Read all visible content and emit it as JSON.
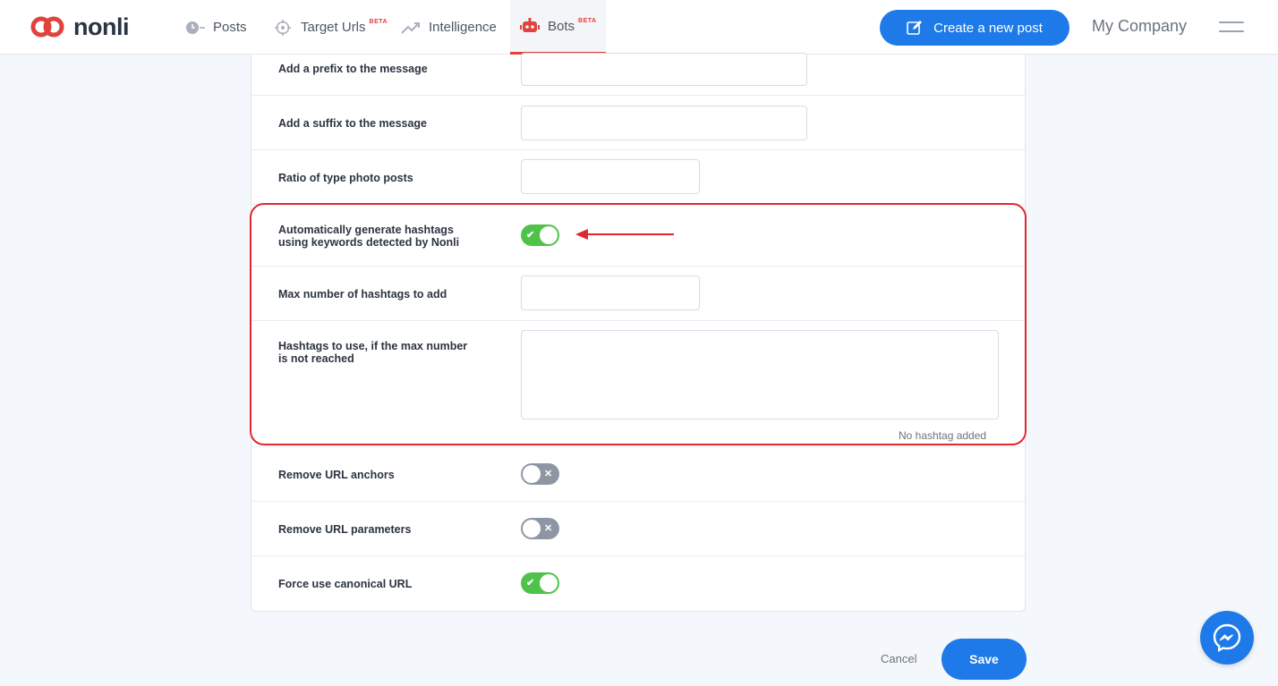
{
  "header": {
    "logo_text": "nonli",
    "nav": [
      {
        "label": "Posts",
        "icon": "clock-icon",
        "beta": ""
      },
      {
        "label": "Target Urls",
        "icon": "target-icon",
        "beta": "BETA"
      },
      {
        "label": "Intelligence",
        "icon": "trending-up-icon",
        "beta": ""
      },
      {
        "label": "Bots",
        "icon": "robot-icon",
        "beta": "BETA"
      }
    ],
    "create_label": "Create a new post",
    "company": "My Company"
  },
  "form": {
    "prefix_label": "Add a prefix to the message",
    "suffix_label": "Add a suffix to the message",
    "ratio_label": "Ratio of type photo posts",
    "auto_hashtags_label_1": "Automatically generate hashtags",
    "auto_hashtags_label_2": "using keywords detected by Nonli",
    "max_hashtags_label": "Max number of hashtags to add",
    "hashtags_use_label_1": "Hashtags to use, if the max number",
    "hashtags_use_label_2": "is not reached",
    "no_hashtag": "No hashtag added",
    "remove_anchors_label": "Remove URL anchors",
    "remove_params_label": "Remove URL parameters",
    "canonical_label": "Force use canonical URL"
  },
  "toggles": {
    "auto_hashtags": "on",
    "remove_anchors": "off",
    "remove_params": "off",
    "canonical": "on",
    "on_mark": "✔",
    "off_mark": "✕"
  },
  "footer": {
    "cancel": "Cancel",
    "save": "Save"
  },
  "colors": {
    "accent": "#1e7ae8",
    "brand": "#e0423c",
    "toggle_on": "#4fc24a",
    "toggle_off": "#8e96a3",
    "highlight": "#e0292e"
  }
}
